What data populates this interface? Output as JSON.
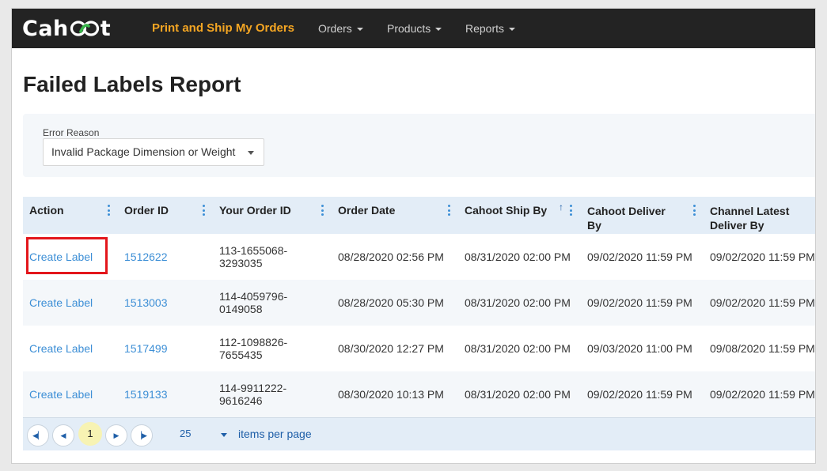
{
  "navbar": {
    "logo_left": "Cah",
    "logo_right": "t",
    "items": [
      {
        "label": "Print and Ship My Orders",
        "active": true
      },
      {
        "label": "Orders",
        "active": false
      },
      {
        "label": "Products",
        "active": false
      },
      {
        "label": "Reports",
        "active": false
      }
    ]
  },
  "page": {
    "title": "Failed Labels Report"
  },
  "filter": {
    "label": "Error Reason",
    "selected": "Invalid Package Dimension or Weight"
  },
  "table": {
    "columns": [
      {
        "line1": "Action",
        "line2": ""
      },
      {
        "line1": "Order ID",
        "line2": ""
      },
      {
        "line1": "Your Order ID",
        "line2": ""
      },
      {
        "line1": "Order Date",
        "line2": ""
      },
      {
        "line1": "Cahoot Ship By",
        "line2": "",
        "sort": "ascending"
      },
      {
        "line1": "Cahoot Deliver",
        "line2": "By"
      },
      {
        "line1": "Channel Latest",
        "line2": "Deliver By"
      }
    ],
    "rows": [
      {
        "action": "Create Label",
        "order_id": "1512622",
        "your_order_id_1": "113-1655068-",
        "your_order_id_2": "3293035",
        "order_date": "08/28/2020 02:56 PM",
        "ship_by": "08/31/2020 02:00 PM",
        "deliver_by": "09/02/2020 11:59 PM",
        "channel_deliver_by": "09/02/2020 11:59 PM"
      },
      {
        "action": "Create Label",
        "order_id": "1513003",
        "your_order_id_1": "114-4059796-",
        "your_order_id_2": "0149058",
        "order_date": "08/28/2020 05:30 PM",
        "ship_by": "08/31/2020 02:00 PM",
        "deliver_by": "09/02/2020 11:59 PM",
        "channel_deliver_by": "09/02/2020 11:59 PM"
      },
      {
        "action": "Create Label",
        "order_id": "1517499",
        "your_order_id_1": "112-1098826-",
        "your_order_id_2": "7655435",
        "order_date": "08/30/2020 12:27 PM",
        "ship_by": "08/31/2020 02:00 PM",
        "deliver_by": "09/03/2020 11:00 PM",
        "channel_deliver_by": "09/08/2020 11:59 PM"
      },
      {
        "action": "Create Label",
        "order_id": "1519133",
        "your_order_id_1": "114-9911222-",
        "your_order_id_2": "9616246",
        "order_date": "08/30/2020 10:13 PM",
        "ship_by": "08/31/2020 02:00 PM",
        "deliver_by": "09/02/2020 11:59 PM",
        "channel_deliver_by": "09/02/2020 11:59 PM"
      }
    ]
  },
  "pager": {
    "current_page": "1",
    "page_size": "25",
    "page_size_label": "items per page"
  },
  "colors": {
    "nav_bg": "#232323",
    "nav_active": "#f5a623",
    "link": "#3d8fd6",
    "header_bg": "#e3edf7",
    "highlight": "#e3161b"
  }
}
